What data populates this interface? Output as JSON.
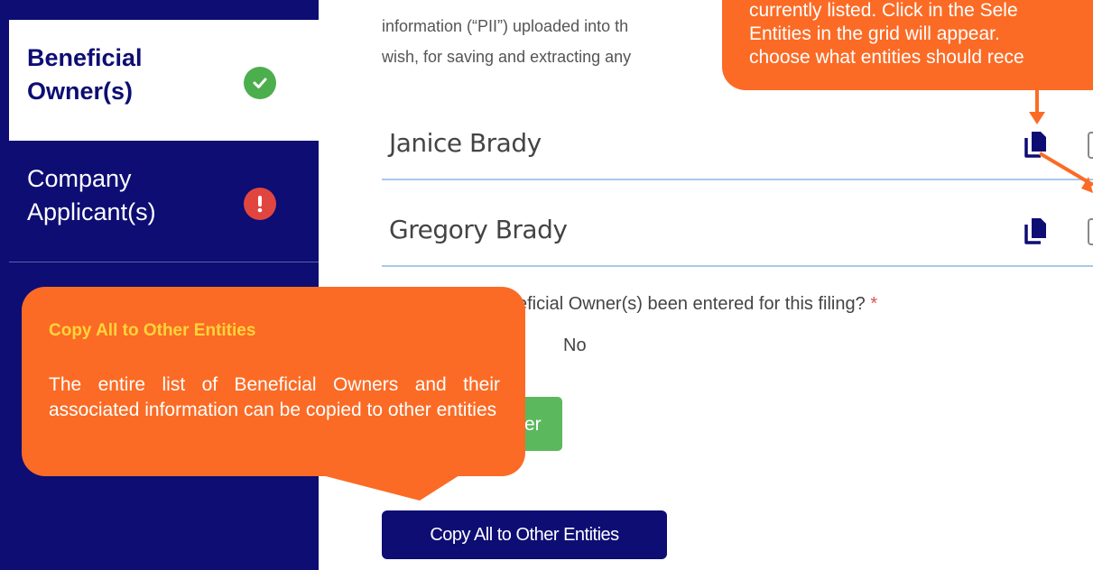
{
  "sidebar": {
    "items": [
      {
        "label_line1": "Beneficial",
        "label_line2": "Owner(s)",
        "status": "complete",
        "status_icon": "check-icon"
      },
      {
        "label_line1": "Company",
        "label_line2": "Applicant(s)",
        "status": "error",
        "status_icon": "exclamation-icon"
      }
    ]
  },
  "main": {
    "intro_line1": "information (“PII”) uploaded into th",
    "intro_line2": "wish, for saving and extracting any",
    "owners": [
      {
        "name": "Janice Brady",
        "copy_icon": "copy-icon"
      },
      {
        "name": "Gregory Brady",
        "copy_icon": "copy-icon"
      }
    ],
    "question": "eficial Owner(s) been entered for this filing?",
    "required_mark": "*",
    "answer": "No",
    "green_button_label": "er",
    "copy_all_label": "Copy All to Other Entities"
  },
  "callouts": {
    "top": {
      "line1": "currently listed. Click in the Sele",
      "line2": "Entities in the grid will appear.",
      "line3": "choose what entities should rece"
    },
    "left": {
      "title": "Copy All to Other Entities",
      "body": "The entire list of Beneficial Owners and their associated information can be copied to other entities"
    }
  },
  "colors": {
    "navy": "#0d0d74",
    "orange": "#fb6b25",
    "callout_title": "#ffd43b",
    "green": "#5cb85c",
    "error_red": "#e0463f",
    "divider_blue": "#a9c8ec"
  }
}
